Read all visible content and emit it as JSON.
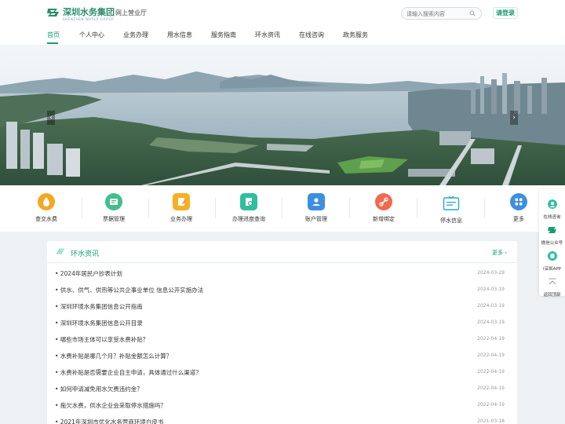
{
  "header": {
    "logo_text": "深圳水务集团",
    "logo_sub": "SHENZHEN WATER GROUP",
    "portal_name": "网上营业厅",
    "search_placeholder": "请输入搜索内容",
    "login_label": "请登录"
  },
  "nav": {
    "items": [
      "首页",
      "个人中心",
      "业务办理",
      "用水信息",
      "服务指南",
      "环水资讯",
      "在线咨询",
      "政务服务"
    ],
    "active": "首页"
  },
  "banner": {
    "prev_label": "‹",
    "next_label": "›"
  },
  "services": [
    {
      "label": "查交水费",
      "icon": "water-bill-icon",
      "color": "#f5a623"
    },
    {
      "label": "票据管理",
      "icon": "invoice-icon",
      "color": "#3fbf8c"
    },
    {
      "label": "业务办理",
      "icon": "document-icon",
      "color": "#f5b027"
    },
    {
      "label": "办理进度查询",
      "icon": "progress-icon",
      "color": "#2fbf9e"
    },
    {
      "label": "账户管理",
      "icon": "account-icon",
      "color": "#3d8fe0"
    },
    {
      "label": "新增绑定",
      "icon": "bind-icon",
      "color": "#f06a4f"
    },
    {
      "label": "停水信息",
      "icon": "water-outage-icon",
      "color": "#2aa8c9"
    },
    {
      "label": "更多",
      "icon": "more-icon",
      "color": "#3d8fe0"
    }
  ],
  "news": {
    "title": "环水资讯",
    "more_label": "更多 ›",
    "items": [
      {
        "title": "• 2024年居民户抄表计划",
        "date": "2024-03-29"
      },
      {
        "title": "• 供水、供气、供热等公共企事业单位 信息公开实施办法",
        "date": "2024-03-19"
      },
      {
        "title": "• 深圳环境水务集团信息公开指南",
        "date": "2024-03-19"
      },
      {
        "title": "• 深圳环境水务集团信息公开目录",
        "date": "2024-03-19"
      },
      {
        "title": "• 哪些市场主体可以享受水费补贴？",
        "date": "2022-04-19"
      },
      {
        "title": "• 水费补贴是哪几个月？补贴金额怎么计算？",
        "date": "2022-04-19"
      },
      {
        "title": "• 水费补贴是否需要企业自主申请，具体通过什么渠道？",
        "date": "2022-04-19"
      },
      {
        "title": "• 如何申请减免用水欠费违约金？",
        "date": "2022-04-19"
      },
      {
        "title": "• 拖欠水费，供水企业会采取停水措施吗？",
        "date": "2022-04-19"
      },
      {
        "title": "• 2021年深圳市优化水务营商环境白皮书",
        "date": "2021-03-18"
      }
    ]
  },
  "float": [
    {
      "label": "在线咨询",
      "icon": "chat-icon",
      "color": "#2fbf9e"
    },
    {
      "label": "微信公众号",
      "icon": "wechat-icon",
      "color": "#1a9c78"
    },
    {
      "label": "i深圳APP",
      "icon": "app-icon",
      "color": "#2fbf9e"
    },
    {
      "label": "返回顶部",
      "icon": "back-to-top-icon",
      "color": "#999999"
    }
  ]
}
